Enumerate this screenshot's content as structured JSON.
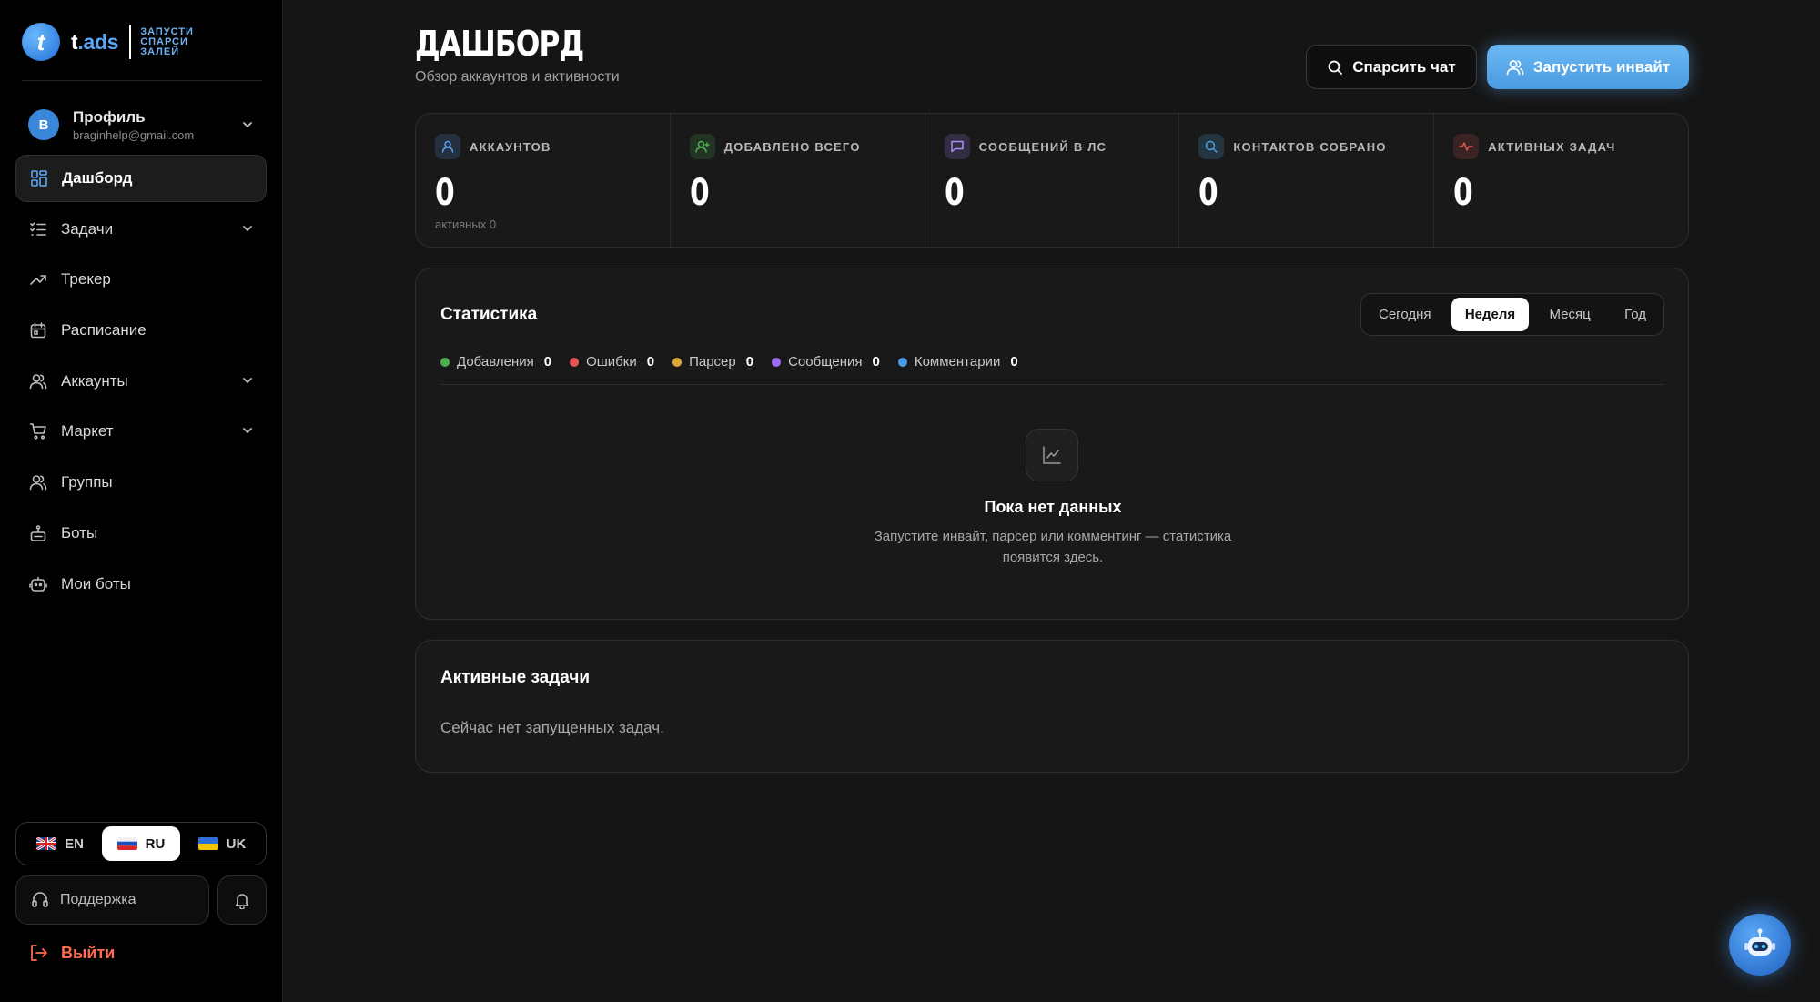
{
  "brand": {
    "name_left": "t",
    "name_right": ".ads",
    "mark": "t",
    "tagline": [
      "ЗАПУСТИ",
      "СПАРСИ",
      "ЗАЛЕЙ"
    ]
  },
  "profile": {
    "initial": "B",
    "name": "Профиль",
    "email": "braginhelp@gmail.com"
  },
  "nav": [
    {
      "label": "Дашборд",
      "icon": "dashboard-icon",
      "active": true
    },
    {
      "label": "Задачи",
      "icon": "tasks-icon",
      "expandable": true
    },
    {
      "label": "Трекер",
      "icon": "trend-icon"
    },
    {
      "label": "Расписание",
      "icon": "calendar-icon"
    },
    {
      "label": "Аккаунты",
      "icon": "users-icon",
      "expandable": true
    },
    {
      "label": "Маркет",
      "icon": "cart-icon",
      "expandable": true
    },
    {
      "label": "Группы",
      "icon": "group-icon"
    },
    {
      "label": "Боты",
      "icon": "bot-icon"
    },
    {
      "label": "Мои боты",
      "icon": "my-bots-icon"
    }
  ],
  "languages": [
    {
      "code": "EN",
      "flag": "uk-flag-icon"
    },
    {
      "code": "RU",
      "flag": "ru-flag-icon",
      "active": true
    },
    {
      "code": "UK",
      "flag": "ua-flag-icon"
    }
  ],
  "support_label": "Поддержка",
  "logout_label": "Выйти",
  "header": {
    "title": "ДАШБОРД",
    "subtitle": "Обзор аккаунтов и активности",
    "parse_button": "Спарсить чат",
    "invite_button": "Запустить инвайт"
  },
  "stats": [
    {
      "label": "АККАУНТОВ",
      "value": "0",
      "note": "активных 0",
      "icon": "user-icon",
      "color": "#5a9df0"
    },
    {
      "label": "ДОБАВЛЕНО ВСЕГО",
      "value": "0",
      "note": "",
      "icon": "user-plus-icon",
      "color": "#4caf50"
    },
    {
      "label": "СООБЩЕНИЙ В ЛС",
      "value": "0",
      "note": "",
      "icon": "message-icon",
      "color": "#9b7cf0"
    },
    {
      "label": "КОНТАКТОВ СОБРАНО",
      "value": "0",
      "note": "",
      "icon": "search-icon",
      "color": "#4aa3e0"
    },
    {
      "label": "АКТИВНЫХ ЗАДАЧ",
      "value": "0",
      "note": "",
      "icon": "pulse-icon",
      "color": "#e05555"
    }
  ],
  "statistics": {
    "title": "Статистика",
    "periods": [
      {
        "label": "Сегодня"
      },
      {
        "label": "Неделя",
        "active": true
      },
      {
        "label": "Месяц"
      },
      {
        "label": "Год"
      }
    ],
    "legend": [
      {
        "label": "Добавления",
        "value": "0",
        "color": "#4caf50"
      },
      {
        "label": "Ошибки",
        "value": "0",
        "color": "#e05555"
      },
      {
        "label": "Парсер",
        "value": "0",
        "color": "#e0a93a"
      },
      {
        "label": "Сообщения",
        "value": "0",
        "color": "#9b6cf0"
      },
      {
        "label": "Комментарии",
        "value": "0",
        "color": "#4a9be8"
      }
    ],
    "empty_title": "Пока нет данных",
    "empty_text": "Запустите инвайт, парсер или комментинг — статистика появится здесь."
  },
  "active_tasks": {
    "title": "Активные задачи",
    "empty": "Сейчас нет запущенных задач."
  }
}
